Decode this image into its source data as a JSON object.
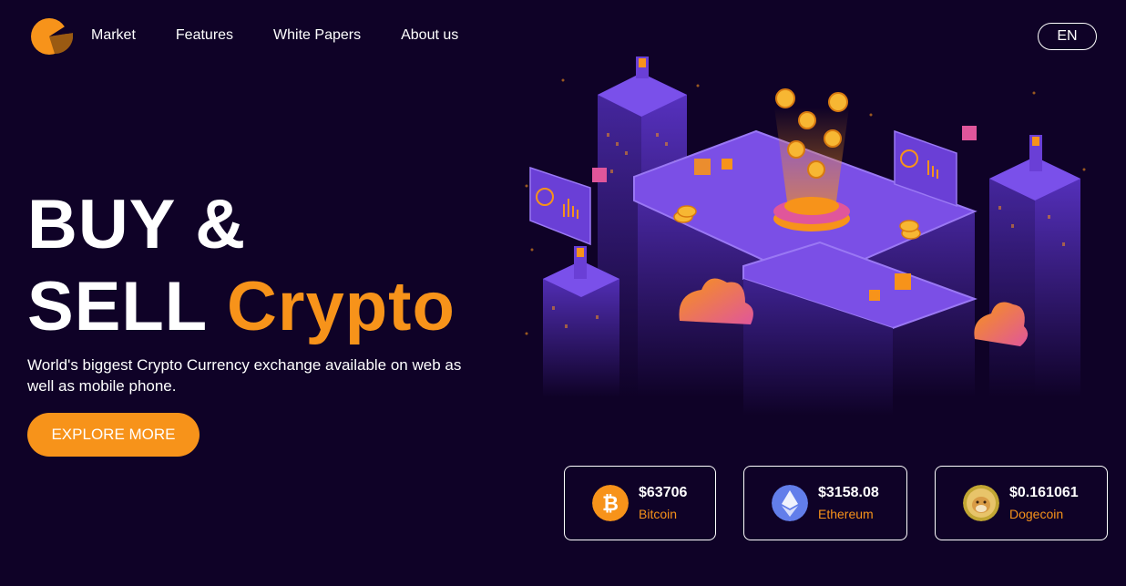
{
  "nav": {
    "items": [
      "Market",
      "Features",
      "White Papers",
      "About us"
    ],
    "language": "EN"
  },
  "hero": {
    "title_line1": "BUY &",
    "title_line2_white": "SELL",
    "title_line2_accent": "Crypto",
    "subtitle": "World's biggest Crypto Currency exchange available on web as well as mobile phone.",
    "cta_label": "EXPLORE MORE"
  },
  "tickers": [
    {
      "price": "$63706",
      "name": "Bitcoin",
      "icon": "bitcoin-icon"
    },
    {
      "price": "$3158.08",
      "name": "Ethereum",
      "icon": "ethereum-icon"
    },
    {
      "price": "$0.161061",
      "name": "Dogecoin",
      "icon": "dogecoin-icon"
    }
  ],
  "colors": {
    "background": "#0f0227",
    "accent": "#f7931a",
    "purple": "#6a3fd6"
  }
}
